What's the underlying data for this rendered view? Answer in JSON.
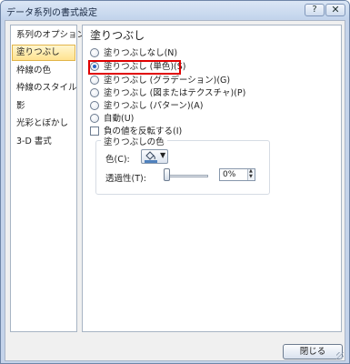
{
  "window": {
    "title": "データ系列の書式設定",
    "help_label": "?",
    "close_label": "✕"
  },
  "sidebar": {
    "items": [
      {
        "label": "系列のオプション"
      },
      {
        "label": "塗りつぶし",
        "selected": true
      },
      {
        "label": "枠線の色"
      },
      {
        "label": "枠線のスタイル"
      },
      {
        "label": "影"
      },
      {
        "label": "光彩とぼかし"
      },
      {
        "label": "3-D 書式"
      }
    ]
  },
  "panel": {
    "title": "塗りつぶし",
    "fill_options": [
      {
        "label": "塗りつぶしなし(N)",
        "checked": false
      },
      {
        "label": "塗りつぶし (単色)(S)",
        "checked": true
      },
      {
        "label": "塗りつぶし (グラデーション)(G)",
        "checked": false
      },
      {
        "label": "塗りつぶし (図またはテクスチャ)(P)",
        "checked": false
      },
      {
        "label": "塗りつぶし (パターン)(A)",
        "checked": false
      },
      {
        "label": "自動(U)",
        "checked": false
      }
    ],
    "invert_if_negative": {
      "label": "負の値を反転する(I)",
      "checked": false
    },
    "fill_color": {
      "group_title": "塗りつぶしの色",
      "color_label": "色(C):",
      "transparency_label": "透過性(T):",
      "transparency_value": "0%",
      "transparency_level": 0
    }
  },
  "footer": {
    "close_button": "閉じる"
  },
  "colors": {
    "highlight": "#e00000",
    "selected_bg": "#ffe28f",
    "title_bar": "#c4d3ea",
    "bucket_fill": "#4f81bd"
  }
}
